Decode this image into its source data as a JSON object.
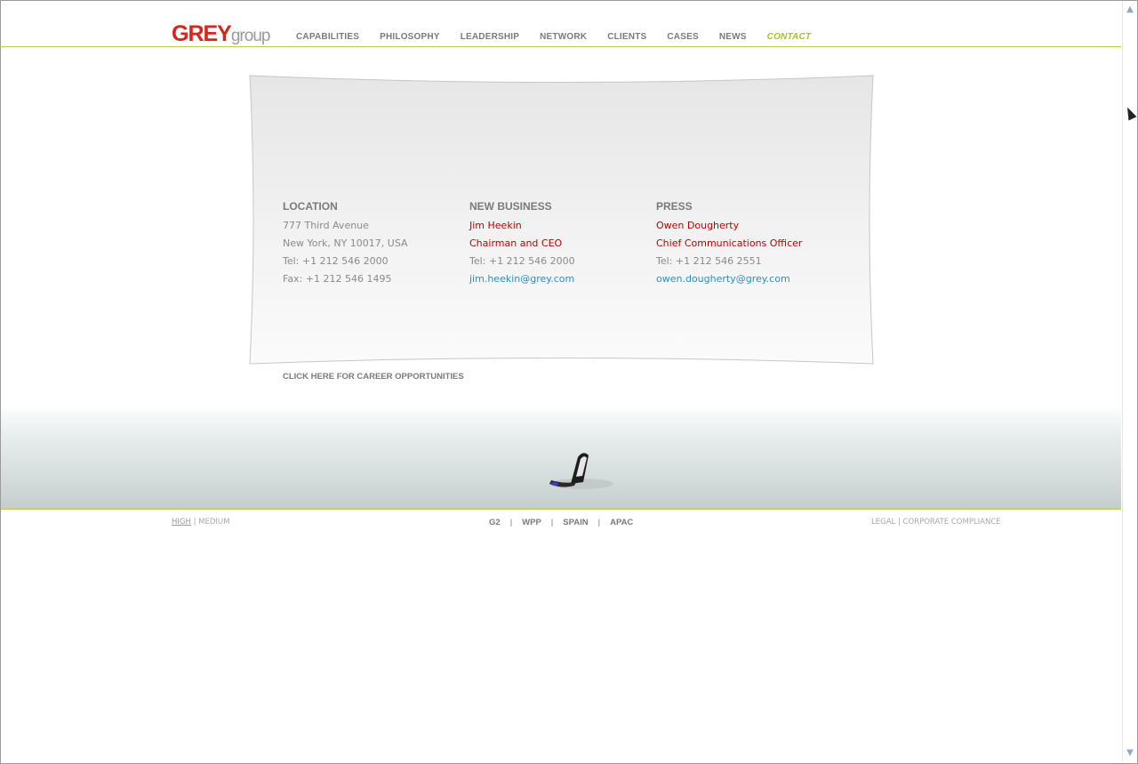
{
  "header": {
    "logo": {
      "main": "GREY",
      "sub": "group"
    },
    "nav": [
      {
        "label": "CAPABILITIES"
      },
      {
        "label": "PHILOSOPHY"
      },
      {
        "label": "LEADERSHIP"
      },
      {
        "label": "NETWORK"
      },
      {
        "label": "CLIENTS"
      },
      {
        "label": "CASES"
      },
      {
        "label": "NEWS"
      },
      {
        "label": "CONTACT",
        "active": true
      }
    ]
  },
  "contact": {
    "location": {
      "heading": "LOCATION",
      "address1": "777 Third Avenue",
      "address2": "New York, NY 10017, USA",
      "tel": "Tel: +1 212 546 2000",
      "fax": "Fax: +1 212 546 1495"
    },
    "new_business": {
      "heading": "NEW BUSINESS",
      "name": "Jim Heekin",
      "title": "Chairman and CEO",
      "tel": "Tel: +1 212 546 2000",
      "email": "jim.heekin@grey.com"
    },
    "press": {
      "heading": "PRESS",
      "name": "Owen Dougherty",
      "title": "Chief Communications Officer",
      "tel": "Tel: +1 212 546 2551",
      "email": "owen.dougherty@grey.com"
    }
  },
  "career_link": "CLICK HERE FOR CAREER OPPORTUNITIES",
  "footer": {
    "bandwidth": {
      "high": "HIGH",
      "sep": "|",
      "medium": "MEDIUM"
    },
    "links": [
      "G2",
      "WPP",
      "SPAIN",
      "APAC"
    ],
    "link_sep": "|",
    "legal": {
      "legal": "LEGAL",
      "sep": "|",
      "compliance": "CORPORATE COMPLIANCE"
    }
  },
  "colors": {
    "brand_red": "#d8261d",
    "accent_green": "#a6c425",
    "link_blue": "#2a8fbf",
    "name_red": "#c00000"
  }
}
